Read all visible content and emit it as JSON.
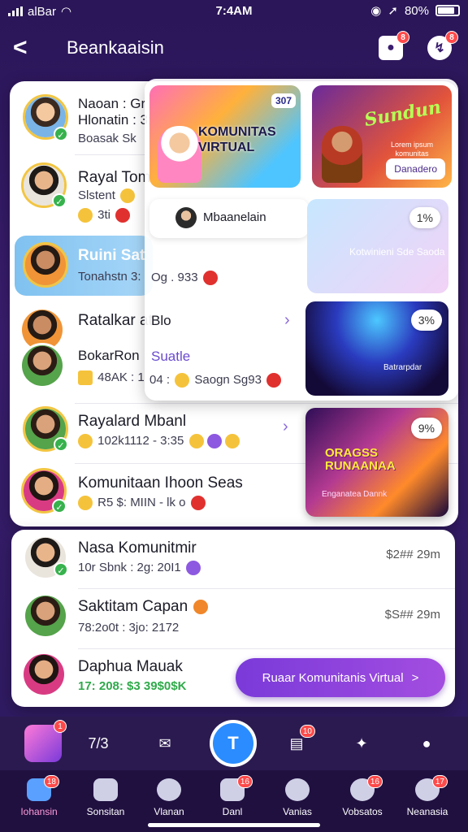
{
  "status": {
    "time": "7:4AM",
    "carrier": "alBar",
    "battery": "80%"
  },
  "header": {
    "back": "<",
    "title": "Beankaaisin",
    "badge1": "8",
    "badge2": "8"
  },
  "rows": [
    {
      "name": "Naoan : Gr",
      "line2": "Hlonatin : 3:",
      "sub": "Boasak Sk"
    },
    {
      "name": "Rayal Tom",
      "sub": "Slstent",
      "sub2": "3ti"
    },
    {
      "name": "Ruini Sat",
      "sub": "Tonahstn 3:"
    },
    {
      "name": "Ratalkar at",
      "sub": "BokarRon"
    },
    {
      "name": "",
      "sub": "48AK : 1"
    },
    {
      "name": "Rayalard Mbanl",
      "sub": "102k1112 - 3:35"
    },
    {
      "name": "Komunitaan Ihoon Seas",
      "sub": "R5 $: MIIN - lk o"
    }
  ],
  "overlay": {
    "banner1_tag": "307",
    "banner1_title": "KOMUNITAS VIRTUAL",
    "banner2_title": "Sundun",
    "banner2_small": "Lorem ipsum komunitas festival",
    "banner2_button": "Danadero",
    "chip_text": "Mbaanelain",
    "tile1_text": "Kotwinieni Sde Saoda",
    "tile1_count": "1%",
    "tile2_count": "3%",
    "tile2_text": "Batrarpdar",
    "line1": "Og . 933",
    "line2": "Blo",
    "line3": "Suatle",
    "line4": "Saogn Sg93",
    "line5": "04 :"
  },
  "tile3": {
    "count": "9%",
    "title": "ORAGSS RUNAANAA",
    "bottom": "Enganatea Dannk"
  },
  "card2": {
    "rows": [
      {
        "name": "Nasa Komunitmir",
        "sub": "10r Sbnk : 2g: 20I1",
        "price": "$2## 29m"
      },
      {
        "name": "Saktitam Capan",
        "sub": "78:2o0t : 3jo: 2172",
        "price": "$S## 29m"
      },
      {
        "name": "Daphua Mauak",
        "sub": "17: 208: $3 39$0$K",
        "price": ""
      }
    ],
    "cta": "Ruaar Komunitanis Virtual",
    "cta_chevron": ">"
  },
  "toolbar": {
    "count": "7/3",
    "badge": "10",
    "center": "T"
  },
  "tabs": [
    {
      "label": "Iohansin",
      "badge": "18"
    },
    {
      "label": "Sonsitan",
      "badge": ""
    },
    {
      "label": "Vlanan",
      "badge": ""
    },
    {
      "label": "Danl",
      "badge": "16"
    },
    {
      "label": "Vanias",
      "badge": ""
    },
    {
      "label": "Vobsatos",
      "badge": "16"
    },
    {
      "label": "Neanasia",
      "badge": "17"
    }
  ],
  "colors": {
    "accent": "#7a3ad9",
    "highlight": "#7fc1f0",
    "badge": "#ff4a4a",
    "verified": "#37b24d"
  }
}
